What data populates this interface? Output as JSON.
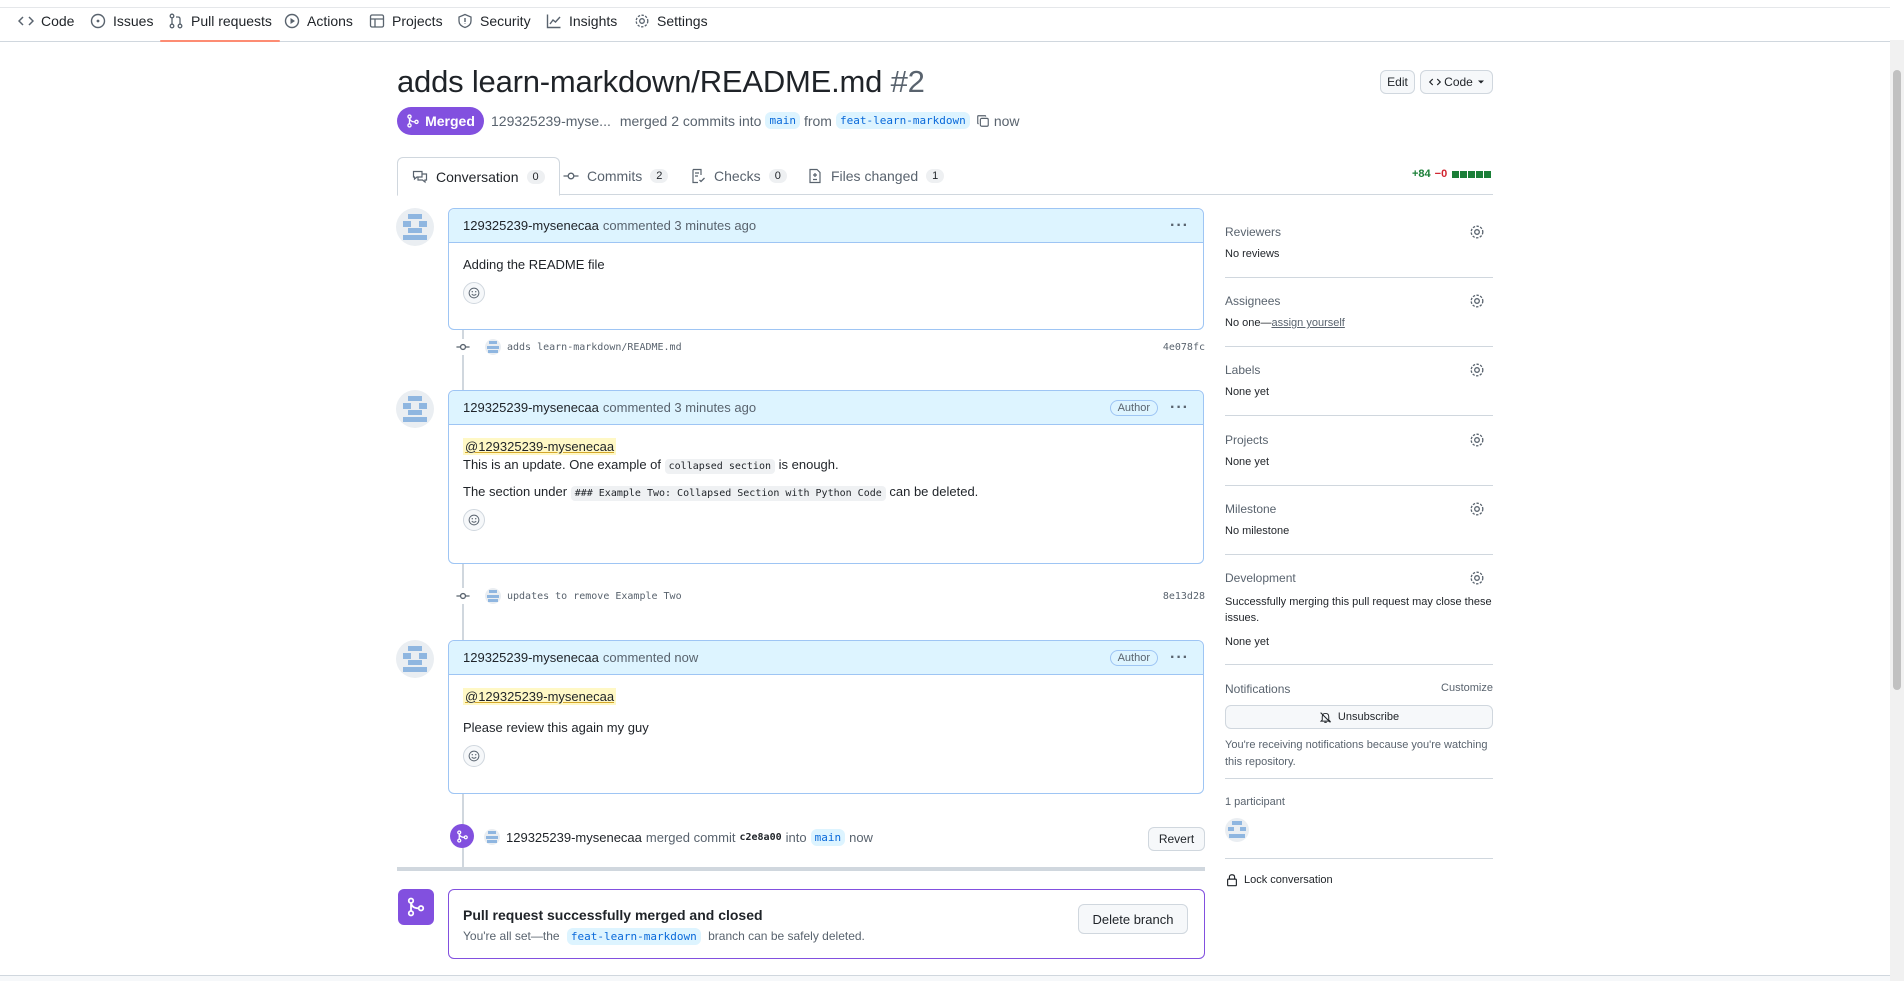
{
  "nav": {
    "items": [
      {
        "label": "Code",
        "icon": "code-icon"
      },
      {
        "label": "Issues",
        "icon": "issue-icon"
      },
      {
        "label": "Pull requests",
        "icon": "pull-request-icon"
      },
      {
        "label": "Actions",
        "icon": "play-icon"
      },
      {
        "label": "Projects",
        "icon": "table-icon"
      },
      {
        "label": "Security",
        "icon": "shield-icon"
      },
      {
        "label": "Insights",
        "icon": "graph-icon"
      },
      {
        "label": "Settings",
        "icon": "gear-icon"
      }
    ],
    "active": "Pull requests"
  },
  "pr": {
    "title": "adds learn-markdown/README.md",
    "number": "#2",
    "edit_label": "Edit",
    "code_label": "Code",
    "state": "Merged",
    "author_short": "129325239-myse...",
    "merged_text": "merged 2 commits into",
    "base_branch": "main",
    "from_text": "from",
    "head_branch": "feat-learn-markdown",
    "time": "now"
  },
  "tabs": [
    {
      "label": "Conversation",
      "count": "0",
      "icon": "comment-discussion-icon"
    },
    {
      "label": "Commits",
      "count": "2",
      "icon": "git-commit-icon"
    },
    {
      "label": "Checks",
      "count": "0",
      "icon": "checklist-icon"
    },
    {
      "label": "Files changed",
      "count": "1",
      "icon": "file-diff-icon"
    }
  ],
  "diffstat": {
    "additions": "+84",
    "deletions": "−0"
  },
  "timeline": {
    "comment1": {
      "author": "129325239-mysenecaa",
      "meta": "commented 3 minutes ago",
      "body": "Adding the README file"
    },
    "commit1": {
      "message": "adds learn-markdown/README.md",
      "sha": "4e078fc"
    },
    "comment2": {
      "author": "129325239-mysenecaa",
      "meta": "commented 3 minutes ago",
      "badge": "Author",
      "mention": "@129325239-mysenecaa",
      "line1_pre": "This is an update. One example of",
      "line1_code": "collapsed section",
      "line1_post": "is enough.",
      "line2_pre": "The section under",
      "line2_code": "### Example Two: Collapsed Section with Python Code",
      "line2_post": "can be deleted."
    },
    "commit2": {
      "message": "updates to remove Example Two",
      "sha": "8e13d28"
    },
    "comment3": {
      "author": "129325239-mysenecaa",
      "meta": "commented now",
      "badge": "Author",
      "mention": "@129325239-mysenecaa",
      "body": "Please review this again my guy"
    },
    "merge_event": {
      "author": "129325239-mysenecaa",
      "text": "merged commit",
      "sha": "c2e8a00",
      "into": "into",
      "branch": "main",
      "time": "now",
      "revert_label": "Revert"
    },
    "merged_box": {
      "title": "Pull request successfully merged and closed",
      "pre": "You're all set—the",
      "branch": "feat-learn-markdown",
      "post": "branch can be safely deleted.",
      "delete_label": "Delete branch"
    }
  },
  "sidebar": {
    "reviewers": {
      "title": "Reviewers",
      "value": "No reviews"
    },
    "assignees": {
      "title": "Assignees",
      "value": "No one—",
      "link": "assign yourself"
    },
    "labels": {
      "title": "Labels",
      "value": "None yet"
    },
    "projects": {
      "title": "Projects",
      "value": "None yet"
    },
    "milestone": {
      "title": "Milestone",
      "value": "No milestone"
    },
    "development": {
      "title": "Development",
      "desc": "Successfully merging this pull request may close these issues.",
      "value": "None yet"
    },
    "notifications": {
      "title": "Notifications",
      "customize": "Customize",
      "unsubscribe": "Unsubscribe",
      "desc": "You're receiving notifications because you're watching this repository."
    },
    "participants": {
      "title": "1 participant"
    },
    "lock": "Lock conversation"
  },
  "colors": {
    "merged": "#8250df",
    "accent": "#0969da",
    "underline": "#fd8c73"
  }
}
